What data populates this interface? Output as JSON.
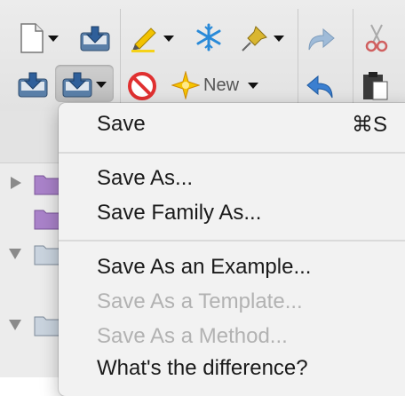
{
  "toolbar": {
    "new_label": "New",
    "icons": [
      "new-document-icon",
      "import-icon",
      "highlighter-icon",
      "freeze-icon",
      "pin-icon",
      "redo-icon",
      "cut-icon",
      "save-icon",
      "save-menu-icon",
      "prohibit-icon",
      "sparkle-icon",
      "undo-icon",
      "paste-icon"
    ]
  },
  "menu": {
    "save": {
      "label": "Save",
      "shortcut": "⌘S"
    },
    "save_as": "Save As...",
    "save_family_as": "Save Family As...",
    "save_as_example": "Save As an Example...",
    "save_as_template": "Save As a Template...",
    "save_as_method": "Save As a Method...",
    "whats_the_difference": "What's the difference?"
  },
  "colors": {
    "menu_background": "#f2f2f2",
    "disabled_text": "#b2b2b2",
    "folder_purple": "#a982c9"
  }
}
